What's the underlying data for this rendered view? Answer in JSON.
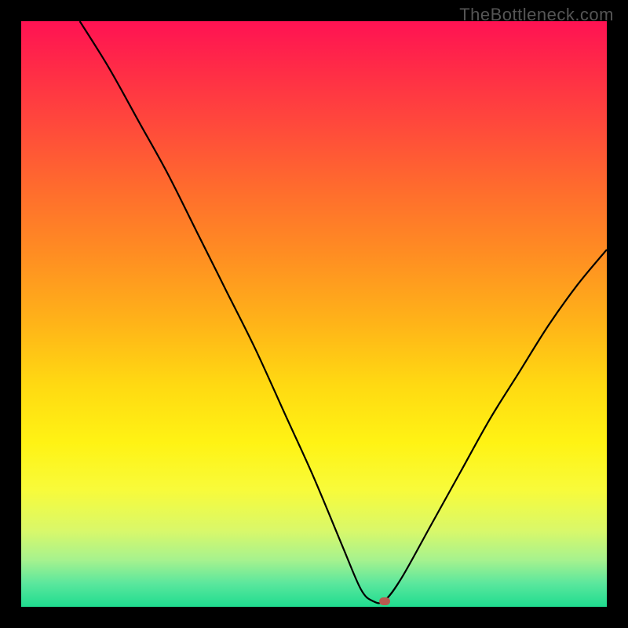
{
  "watermark": "TheBottleneck.com",
  "colors": {
    "frame": "#000000",
    "watermark": "#555555",
    "curve": "#000000",
    "marker": "#b9594f",
    "gradient_top": "#ff1253",
    "gradient_bottom": "#1fdc8f"
  },
  "chart_data": {
    "type": "line",
    "title": "",
    "xlabel": "",
    "ylabel": "",
    "xlim": [
      0,
      100
    ],
    "ylim": [
      0,
      100
    ],
    "grid": false,
    "legend": false,
    "series": [
      {
        "name": "bottleneck-curve",
        "x": [
          10,
          15,
          20,
          25,
          30,
          35,
          40,
          45,
          50,
          55,
          58,
          60,
          62,
          65,
          70,
          75,
          80,
          85,
          90,
          95,
          100
        ],
        "y": [
          100,
          92,
          83,
          74,
          64,
          54,
          44,
          33,
          22,
          10,
          3,
          1,
          1,
          5,
          14,
          23,
          32,
          40,
          48,
          55,
          61
        ]
      }
    ],
    "annotations": [
      {
        "name": "marker",
        "x": 62,
        "y": 1,
        "color": "#b9594f"
      }
    ]
  }
}
